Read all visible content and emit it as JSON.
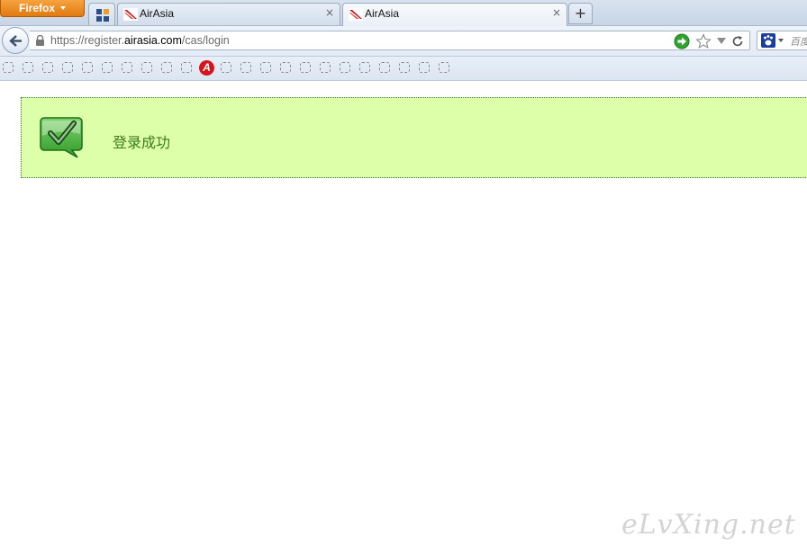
{
  "browser": {
    "menu_label": "Firefox",
    "tabs": [
      {
        "title": "AirAsia",
        "close": "×",
        "active": false
      },
      {
        "title": "AirAsia",
        "close": "×",
        "active": true
      }
    ],
    "new_tab_label": "+",
    "url": {
      "prefix": "https://register.",
      "domain": "airasia.com",
      "path": "/cas/login"
    },
    "search": {
      "placeholder": "百度"
    }
  },
  "content": {
    "message": "登录成功",
    "watermark": "eLvXing.net"
  },
  "colors": {
    "success_bg": "#ddffaa",
    "success_border": "#2e7d32",
    "success_text": "#3d7a1e",
    "firefox_orange": "#e88a1c",
    "airasia_red": "#d6141b"
  }
}
